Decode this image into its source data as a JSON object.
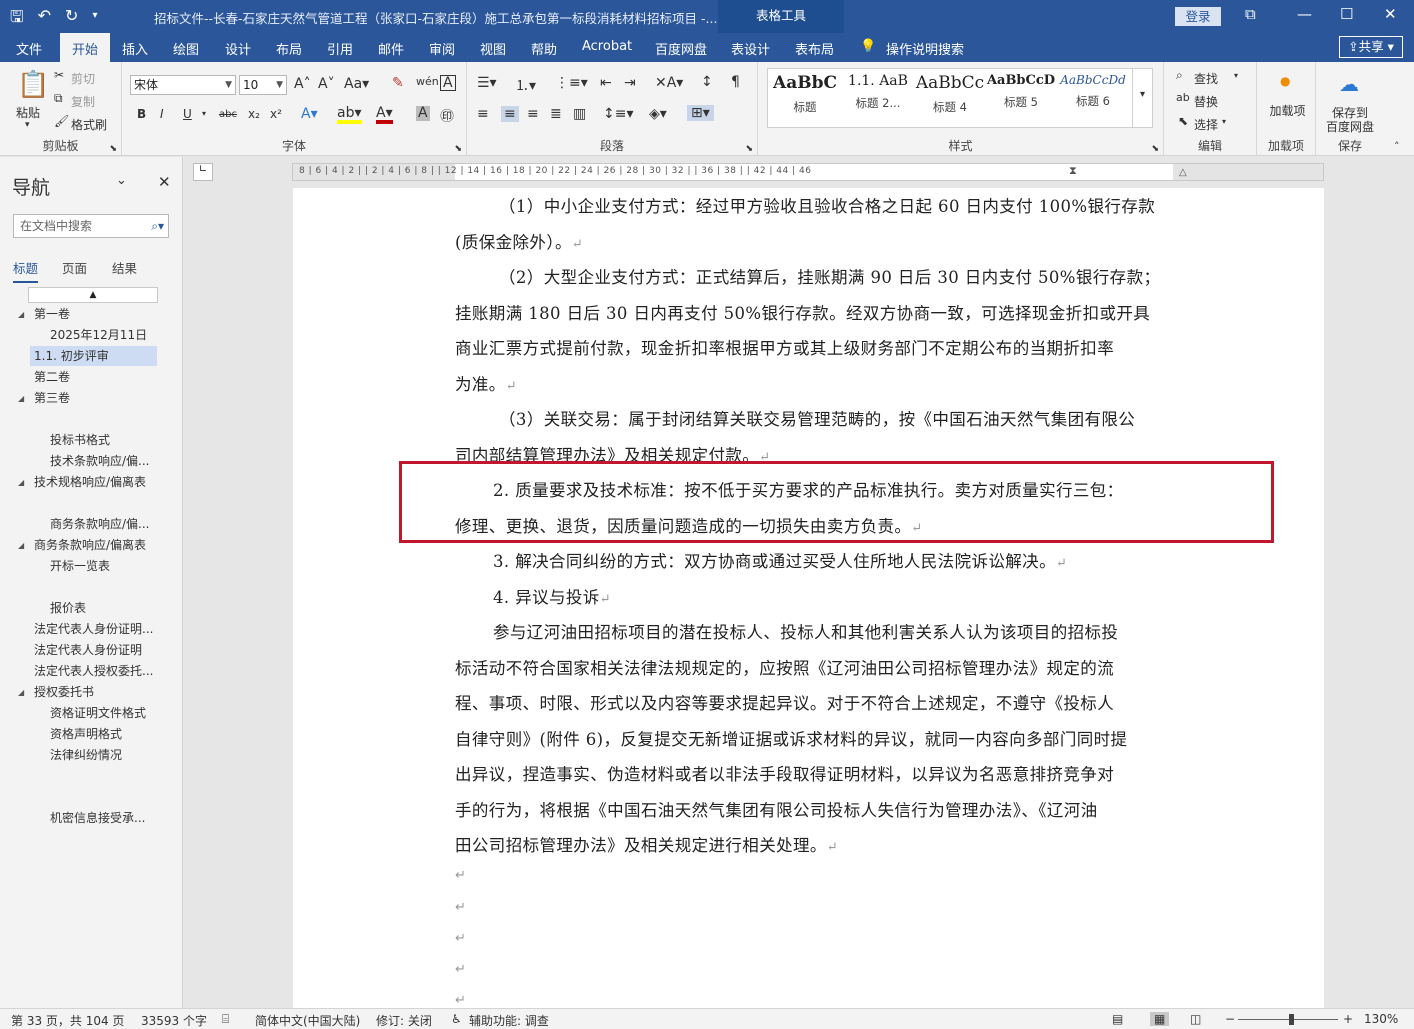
{
  "titlebar": {
    "doc_title": "招标文件--长春-石家庄天然气管道工程（张家口-石家庄段）施工总承包第一标段消耗材料招标项目 -...",
    "table_tools": "表格工具",
    "login": "登录"
  },
  "tabs": [
    "文件",
    "开始",
    "插入",
    "绘图",
    "设计",
    "布局",
    "引用",
    "邮件",
    "审阅",
    "视图",
    "帮助",
    "Acrobat",
    "百度网盘",
    "表设计",
    "表布局"
  ],
  "tell_me": "操作说明搜索",
  "share": "共享",
  "ribbon": {
    "clipboard": {
      "paste": "粘贴",
      "cut": "剪切",
      "copy": "复制",
      "format_painter": "格式刷",
      "label": "剪贴板"
    },
    "font": {
      "name": "宋体",
      "size": "10",
      "label": "字体"
    },
    "paragraph": {
      "label": "段落"
    },
    "styles": {
      "label": "样式",
      "items": [
        {
          "sample": "AaBbC",
          "name": "标题"
        },
        {
          "sample": "1.1. AaB",
          "name": "标题 2..."
        },
        {
          "sample": "AaBbCc",
          "name": "标题 4"
        },
        {
          "sample": "AaBbCcD",
          "name": "标题 5"
        },
        {
          "sample": "AaBbCcDd",
          "name": "标题 6"
        }
      ]
    },
    "editing": {
      "find": "查找",
      "replace": "替换",
      "select": "选择",
      "label": "编辑"
    },
    "addins": {
      "btn": "加载项",
      "label": "加载项"
    },
    "save": {
      "btn1": "保存到",
      "btn2": "百度网盘",
      "label": "保存"
    }
  },
  "nav": {
    "title": "导航",
    "search_placeholder": "在文档中搜索",
    "tabs": [
      "标题",
      "页面",
      "结果"
    ],
    "items": [
      {
        "text": "第一卷",
        "collapsible": true
      },
      {
        "text": "2025年12月11日"
      },
      {
        "text": "1.1. 初步评审",
        "selected": true
      },
      {
        "text": "第二卷"
      },
      {
        "text": "第三卷",
        "collapsible": true
      },
      {
        "text": "投标书格式"
      },
      {
        "text": "技术条款响应/偏..."
      },
      {
        "text": "技术规格响应/偏离表",
        "collapsible": true
      },
      {
        "text": "商务条款响应/偏..."
      },
      {
        "text": "商务条款响应/偏离表",
        "collapsible": true
      },
      {
        "text": "开标一览表"
      },
      {
        "text": "报价表"
      },
      {
        "text": "法定代表人身份证明..."
      },
      {
        "text": "法定代表人身份证明"
      },
      {
        "text": "法定代表人授权委托..."
      },
      {
        "text": "授权委托书",
        "collapsible": true
      },
      {
        "text": "资格证明文件格式"
      },
      {
        "text": "资格声明格式"
      },
      {
        "text": "法律纠纷情况"
      },
      {
        "text": "机密信息接受承..."
      }
    ]
  },
  "ruler": {
    "marks": "8 | 6 | 4 | 2 |     | 2 | 4 | 6 | 8 |     | 12 | 14 | 16 | 18 | 20 | 22 | 24 | 26 | 28 | 30 | 32 |     | 36 | 38 |     | 42 | 44 | 46"
  },
  "document": {
    "lines": [
      "（1）中小企业支付方式：经过甲方验收且验收合格之日起 60 日内支付 100%银行存款",
      "(质保金除外）。",
      "（2）大型企业支付方式：正式结算后，挂账期满 90 日后 30 日内支付 50%银行存款；",
      "挂账期满 180 日后 30 日内再支付 50%银行存款。经双方协商一致，可选择现金折扣或开具",
      "商业汇票方式提前付款，现金折扣率根据甲方或其上级财务部门不定期公布的当期折扣率",
      "为准。",
      "（3）关联交易：属于封闭结算关联交易管理范畴的，按《中国石油天然气集团有限公",
      "司内部结算管理办法》及相关规定付款。",
      "2. 质量要求及技术标准：按不低于买方要求的产品标准执行。卖方对质量实行三包：",
      "修理、更换、退货，因质量问题造成的一切损失由卖方负责。",
      "3. 解决合同纠纷的方式：双方协商或通过买受人住所地人民法院诉讼解决。",
      "4. 异议与投诉",
      "参与辽河油田招标项目的潜在投标人、投标人和其他利害关系人认为该项目的招标投",
      "标活动不符合国家相关法律法规规定的，应按照《辽河油田公司招标管理办法》规定的流",
      "程、事项、时限、形式以及内容等要求提起异议。对于不符合上述规定，不遵守《投标人",
      "自律守则》(附件 6)，反复提交无新增证据或诉求材料的异议，就同一内容向多部门同时提",
      "出异议，捏造事实、伪造材料或者以非法手段取得证明材料，以异议为名恶意排挤竞争对",
      "手的行为，将根据《中国石油天然气集团有限公司投标人失信行为管理办法》、《辽河油",
      "田公司招标管理办法》及相关规定进行相关处理。"
    ]
  },
  "status": {
    "page": "第 33 页，共 104 页",
    "words": "33593 个字",
    "language": "简体中文(中国大陆)",
    "track": "修订: 关闭",
    "accessibility": "辅助功能: 调查",
    "zoom": "130%"
  }
}
